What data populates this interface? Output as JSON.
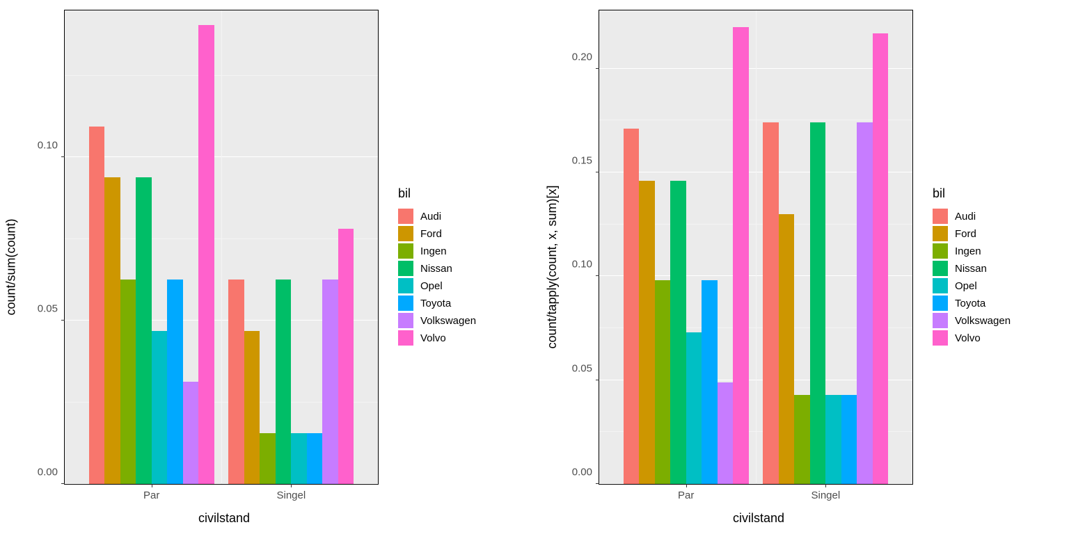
{
  "colors": {
    "Audi": "#F8766D",
    "Ford": "#CD9600",
    "Ingen": "#7CAE00",
    "Nissan": "#00BE67",
    "Opel": "#00BFC4",
    "Toyota": "#00A9FF",
    "Volkswagen": "#C77CFF",
    "Volvo": "#FF61CC"
  },
  "legend_title": "bil",
  "legend_items": [
    "Audi",
    "Ford",
    "Ingen",
    "Nissan",
    "Opel",
    "Toyota",
    "Volkswagen",
    "Volvo"
  ],
  "chart_data": [
    {
      "id": "left",
      "type": "bar",
      "xlabel": "civilstand",
      "ylabel": "count/sum(count)",
      "categories": [
        "Par",
        "Singel"
      ],
      "series": [
        {
          "name": "Audi",
          "values": [
            0.1094,
            0.0625
          ]
        },
        {
          "name": "Ford",
          "values": [
            0.0938,
            0.0469
          ]
        },
        {
          "name": "Ingen",
          "values": [
            0.0625,
            0.0156
          ]
        },
        {
          "name": "Nissan",
          "values": [
            0.0938,
            0.0625
          ]
        },
        {
          "name": "Opel",
          "values": [
            0.0469,
            0.0156
          ]
        },
        {
          "name": "Toyota",
          "values": [
            0.0625,
            0.0156
          ]
        },
        {
          "name": "Volkswagen",
          "values": [
            0.0313,
            0.0625
          ]
        },
        {
          "name": "Volvo",
          "values": [
            0.1406,
            0.0781
          ]
        }
      ],
      "ylim": [
        0,
        0.145
      ],
      "y_ticks": [
        0.0,
        0.05,
        0.1
      ],
      "y_tick_labels": [
        "0.00",
        "0.05",
        "0.10"
      ],
      "y_minor": [
        0.025,
        0.075,
        0.125
      ]
    },
    {
      "id": "right",
      "type": "bar",
      "xlabel": "civilstand",
      "ylabel": "count/tapply(count, x, sum)[x]",
      "categories": [
        "Par",
        "Singel"
      ],
      "series": [
        {
          "name": "Audi",
          "values": [
            0.171,
            0.174
          ]
        },
        {
          "name": "Ford",
          "values": [
            0.146,
            0.13
          ]
        },
        {
          "name": "Ingen",
          "values": [
            0.098,
            0.043
          ]
        },
        {
          "name": "Nissan",
          "values": [
            0.146,
            0.174
          ]
        },
        {
          "name": "Opel",
          "values": [
            0.073,
            0.043
          ]
        },
        {
          "name": "Toyota",
          "values": [
            0.098,
            0.043
          ]
        },
        {
          "name": "Volkswagen",
          "values": [
            0.049,
            0.174
          ]
        },
        {
          "name": "Volvo",
          "values": [
            0.22,
            0.217
          ]
        }
      ],
      "ylim": [
        0,
        0.228
      ],
      "y_ticks": [
        0.0,
        0.05,
        0.1,
        0.15,
        0.2
      ],
      "y_tick_labels": [
        "0.00",
        "0.05",
        "0.10",
        "0.15",
        "0.20"
      ],
      "y_minor": [
        0.025,
        0.075,
        0.125,
        0.175
      ]
    }
  ]
}
